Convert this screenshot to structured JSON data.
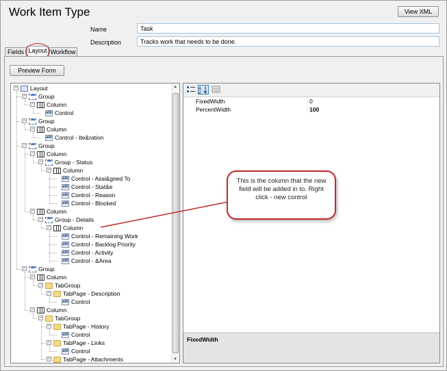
{
  "window": {
    "title": "Work Item Type",
    "view_xml_label": "View XML"
  },
  "fields": {
    "name_label": "Name",
    "name_value": "Task",
    "description_label": "Description",
    "description_value": "Tracks work that needs to be done."
  },
  "tabs": [
    {
      "label": "Fields"
    },
    {
      "label": "Layout"
    },
    {
      "label": "Workflow"
    }
  ],
  "layout": {
    "preview_label": "Preview Form"
  },
  "tree": {
    "nodes": [
      {
        "label": "Layout",
        "icon": "layout-icon"
      },
      {
        "label": "Group",
        "icon": "group-icon"
      },
      {
        "label": "Column",
        "icon": "column-icon"
      },
      {
        "label": "Control",
        "icon": "control-icon"
      },
      {
        "label": "Group",
        "icon": "group-icon"
      },
      {
        "label": "Column",
        "icon": "column-icon"
      },
      {
        "label": "Control - Ite&ration",
        "icon": "control-icon"
      },
      {
        "label": "Group",
        "icon": "group-icon"
      },
      {
        "label": "Column",
        "icon": "column-icon"
      },
      {
        "label": "Group - Status",
        "icon": "group-icon"
      },
      {
        "label": "Column",
        "icon": "column-icon"
      },
      {
        "label": "Control - Assi&gned To",
        "icon": "control-icon"
      },
      {
        "label": "Control - Stat&e",
        "icon": "control-icon"
      },
      {
        "label": "Control - Reason",
        "icon": "control-icon"
      },
      {
        "label": "Control - Blocked",
        "icon": "control-icon"
      },
      {
        "label": "Column",
        "icon": "column-icon"
      },
      {
        "label": "Group - Details",
        "icon": "group-icon"
      },
      {
        "label": "Column",
        "icon": "column-icon"
      },
      {
        "label": "Control - Remaining Work",
        "icon": "control-icon"
      },
      {
        "label": "Control - Backlog Priority",
        "icon": "control-icon"
      },
      {
        "label": "Control - Activity",
        "icon": "control-icon"
      },
      {
        "label": "Control - &Area",
        "icon": "control-icon"
      },
      {
        "label": "Group",
        "icon": "group-icon"
      },
      {
        "label": "Column",
        "icon": "column-icon"
      },
      {
        "label": "TabGroup",
        "icon": "folder-icon"
      },
      {
        "label": "TabPage - Description",
        "icon": "folder-icon"
      },
      {
        "label": "Control",
        "icon": "control-icon"
      },
      {
        "label": "Column",
        "icon": "column-icon"
      },
      {
        "label": "TabGroup",
        "icon": "folder-icon"
      },
      {
        "label": "TabPage - History",
        "icon": "folder-icon"
      },
      {
        "label": "Control",
        "icon": "control-icon"
      },
      {
        "label": "TabPage - Links",
        "icon": "folder-icon"
      },
      {
        "label": "Control",
        "icon": "control-icon"
      },
      {
        "label": "TabPage - Attachments",
        "icon": "folder-icon"
      }
    ]
  },
  "properties": {
    "rows": [
      {
        "name": "FixedWidth",
        "value": "0"
      },
      {
        "name": "PercentWidth",
        "value": "100"
      }
    ],
    "description_title": "FixedWidth"
  },
  "callout": {
    "text": "This is the column that the new field will be added in to. Right click - new control"
  },
  "colors": {
    "callout_border": "#c0282b",
    "field_border": "#a9c6e0"
  }
}
